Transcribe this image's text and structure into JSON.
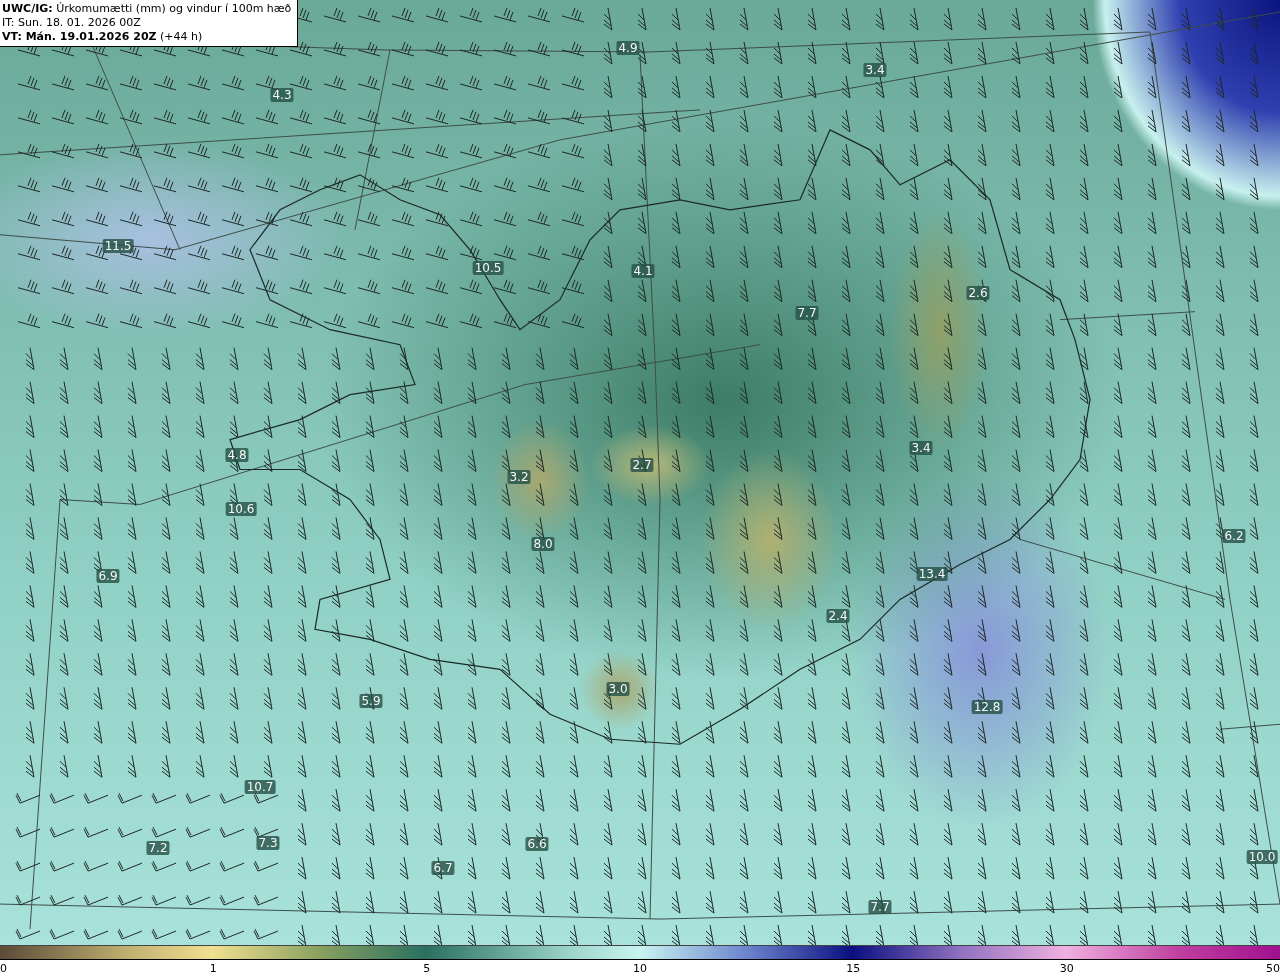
{
  "header": {
    "lines": [
      "**UWC/IG:** Úrkomumætti (mm) og vindur í 100m hæð",
      "IT: Sun. 18. 01. 2026 00Z",
      "**VT: Mán. 19.01.2026 20Z** (+44 h)"
    ]
  },
  "map": {
    "value_labels": [
      "4.9",
      "4.3",
      "3.4",
      "11.5",
      "10.5",
      "4.1",
      "7.7",
      "2.6",
      "4.8",
      "3.2",
      "2.7",
      "3.4",
      "10.6",
      "8.0",
      "6.9",
      "13.4",
      "6.2",
      "2.4",
      "3.0",
      "5.9",
      "12.8",
      "10.7",
      "7.2",
      "7.3",
      "6.6",
      "6.7",
      "7.7",
      "10.0"
    ]
  },
  "colorbar": {
    "ticks": [
      "0",
      "1",
      "5",
      "10",
      "15",
      "30",
      "50"
    ]
  }
}
